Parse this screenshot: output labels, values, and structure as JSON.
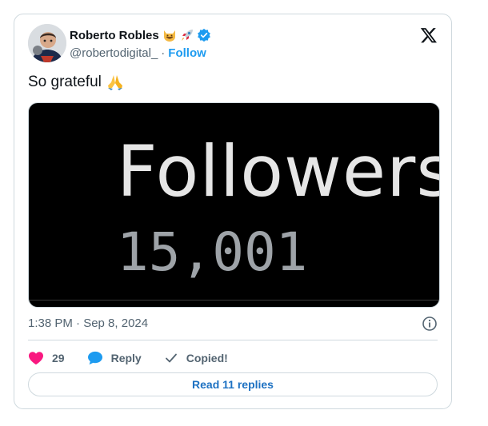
{
  "author": {
    "name": "Roberto Robles",
    "handle": "@robertodigital_",
    "separator": "·",
    "follow_label": "Follow"
  },
  "tweet": {
    "text": "So grateful",
    "timestamp": "1:38 PM · Sep 8, 2024"
  },
  "media": {
    "title": "Followers",
    "count": "15,001"
  },
  "actions": {
    "likes": "29",
    "reply_label": "Reply",
    "copied_label": "Copied!",
    "read_replies_label": "Read 11 replies"
  },
  "colors": {
    "accent": "#1d9bf0",
    "like": "#f91880",
    "text_secondary": "#536471"
  },
  "icons": [
    "cat-emoji-icon",
    "rocket-emoji-icon",
    "verified-badge-icon",
    "x-logo-icon",
    "pray-emoji-icon",
    "info-icon",
    "heart-icon",
    "reply-bubble-icon",
    "check-icon"
  ]
}
